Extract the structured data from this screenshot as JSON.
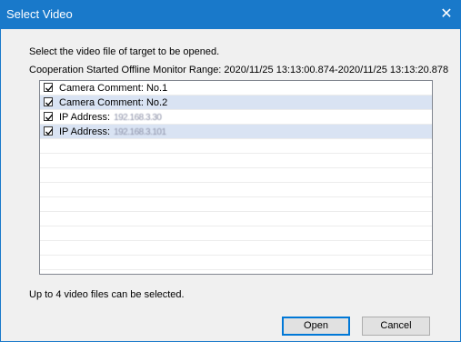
{
  "window": {
    "title": "Select Video"
  },
  "instructions": {
    "line1": "Select the video file of target to be opened.",
    "line2": "Cooperation Started Offline Monitor Range: 2020/11/25  13:13:00.874-2020/11/25  13:13:20.878"
  },
  "videos": [
    {
      "label": "Camera Comment: No.1",
      "value": "",
      "checked": true
    },
    {
      "label": "Camera Comment: No.2",
      "value": "",
      "checked": true
    },
    {
      "label": "IP Address:",
      "value": "192.168.3.30",
      "checked": true
    },
    {
      "label": "IP Address:",
      "value": "192.168.3.101",
      "checked": true
    }
  ],
  "footer_note": "Up to 4 video files can be selected.",
  "buttons": {
    "open": "Open",
    "cancel": "Cancel"
  },
  "colors": {
    "titlebar": "#1979ca",
    "selected_row": "#d9e3f3"
  },
  "icons": {
    "close": "close-icon",
    "checkbox": "checkbox-checked-icon"
  }
}
